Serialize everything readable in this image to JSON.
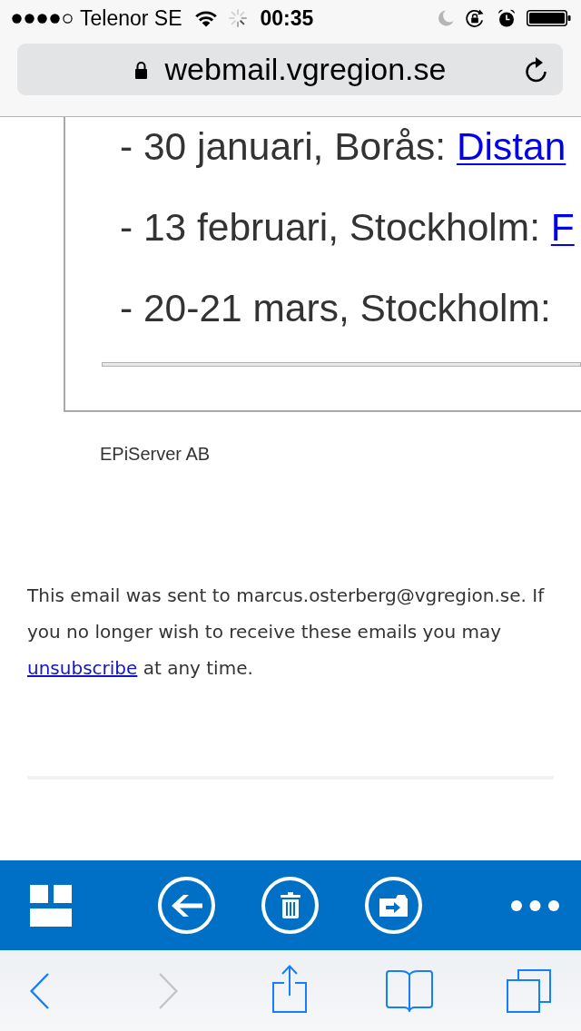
{
  "status_bar": {
    "carrier": "Telenor SE",
    "time": "00:35"
  },
  "address_bar": {
    "url": "webmail.vgregion.se"
  },
  "email": {
    "events": [
      {
        "text": "- 30 januari, Borås:",
        "link": "Distan"
      },
      {
        "text": "- 13 februari, Stockholm:",
        "link": "F"
      },
      {
        "text": "- 20-21 mars, Stockholm:"
      }
    ],
    "company": "EPiServer AB",
    "footer": {
      "before": "This email was sent to marcus.osterberg@vgregion.se. If you no longer wish to receive these emails you may",
      "link": "unsubscribe",
      "after": "at any time."
    }
  },
  "browser_toolbar": {
    "back": {
      "disabled": false
    },
    "forward": {
      "disabled": true
    }
  }
}
